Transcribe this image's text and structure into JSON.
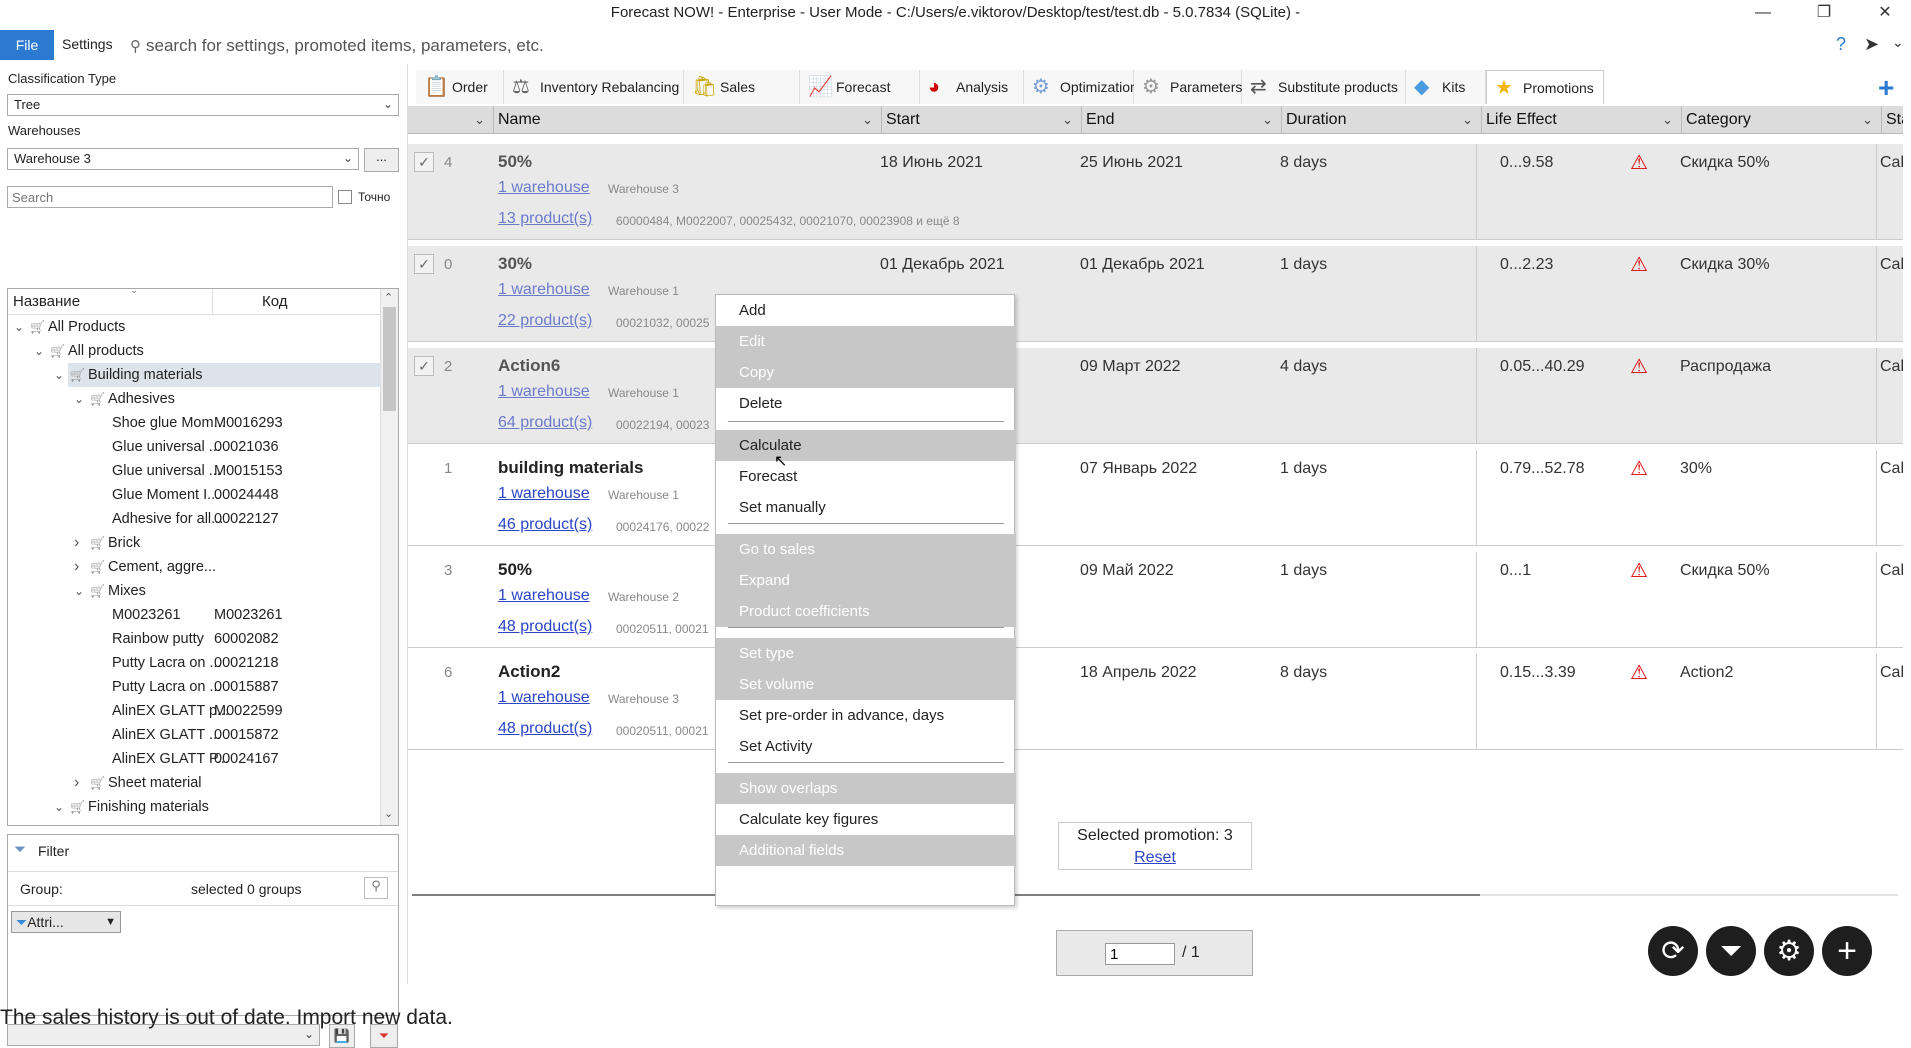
{
  "window": {
    "title": "Forecast NOW! - Enterprise - User Mode - C:/Users/e.viktorov/Desktop/test/test.db - 5.0.7834 (SQLite) -",
    "minimize": "—",
    "restore": "❐",
    "close": "✕"
  },
  "menubar": {
    "file": "File",
    "settings": "Settings",
    "search_placeholder": "search for settings, promoted items, parameters, etc.",
    "help": "?",
    "send": "➤",
    "chevron": "⌄"
  },
  "left": {
    "classification_label": "Classification Type",
    "classification_value": "Tree",
    "warehouses_label": "Warehouses",
    "warehouse_value": "Warehouse 3",
    "more_btn": "...",
    "search_placeholder": "Search",
    "exact_label": "Точно",
    "tree_header_name": "Название",
    "tree_header_code": "Код",
    "tree": [
      {
        "label": "All Products",
        "code": ""
      },
      {
        "label": "All products",
        "code": ""
      },
      {
        "label": "Building materials",
        "code": ""
      },
      {
        "label": "Adhesives",
        "code": ""
      },
      {
        "label": "Shoe glue Mom...",
        "code": "M0016293"
      },
      {
        "label": "Glue universal ...",
        "code": "00021036"
      },
      {
        "label": "Glue universal ...",
        "code": "M0015153"
      },
      {
        "label": "Glue Moment I...",
        "code": "00024448"
      },
      {
        "label": "Adhesive for all...",
        "code": "00022127"
      },
      {
        "label": "Brick",
        "code": ""
      },
      {
        "label": "Cement, aggre...",
        "code": ""
      },
      {
        "label": "Mixes",
        "code": ""
      },
      {
        "label": "M0023261",
        "code": "M0023261"
      },
      {
        "label": "Rainbow putty",
        "code": "60002082"
      },
      {
        "label": "Putty Lacra on ...",
        "code": "00021218"
      },
      {
        "label": "Putty Lacra on ...",
        "code": "00015887"
      },
      {
        "label": "AlinEX GLATT p...",
        "code": "M0022599"
      },
      {
        "label": "AlinEX GLATT ...",
        "code": "00015872"
      },
      {
        "label": "AlinEX GLATT P...",
        "code": "00024167"
      },
      {
        "label": "Sheet material",
        "code": ""
      },
      {
        "label": "Finishing materials",
        "code": ""
      }
    ],
    "filter_title": "Filter",
    "group_label": "Group:",
    "group_value": "selected 0 groups",
    "attr_btn": "Attri..."
  },
  "tabs": [
    {
      "label": "Order",
      "icon": "order-icon",
      "glyph": "📋"
    },
    {
      "label": "Inventory Rebalancing",
      "icon": "scales-icon",
      "glyph": "⚖"
    },
    {
      "label": "Sales",
      "icon": "sales-icon",
      "glyph": "🛍"
    },
    {
      "label": "Forecast",
      "icon": "chart-icon",
      "glyph": "📈"
    },
    {
      "label": "Analysis",
      "icon": "pie-icon",
      "glyph": "◕"
    },
    {
      "label": "Optimization",
      "icon": "optimization-icon",
      "glyph": "⚙"
    },
    {
      "label": "Parameters",
      "icon": "gear-icon",
      "glyph": "⚙"
    },
    {
      "label": "Substitute products",
      "icon": "substitute-icon",
      "glyph": "⇄"
    },
    {
      "label": "Kits",
      "icon": "box-icon",
      "glyph": "◆"
    },
    {
      "label": "Promotions",
      "icon": "star-icon",
      "glyph": "★"
    }
  ],
  "grid": {
    "headers": [
      "Name",
      "Start",
      "End",
      "Duration",
      "Life Effect",
      "Category",
      "Sta"
    ],
    "rows": [
      {
        "checked": true,
        "idx": "4",
        "name": "50%",
        "start": "18 Июнь 2021",
        "end": "25 Июнь 2021",
        "duration": "8 days",
        "life": "0...9.58",
        "category": "Скидка 50%",
        "status": "Cal",
        "wh_link": "1 warehouse",
        "wh": "Warehouse 3",
        "prod_link": "13 product(s)",
        "prods": "60000484, M0022007, 00025432, 00021070, 00023908 и ещё 8"
      },
      {
        "checked": true,
        "idx": "0",
        "name": "30%",
        "start": "01 Декабрь 2021",
        "end": "01 Декабрь 2021",
        "duration": "1 days",
        "life": "0...2.23",
        "category": "Скидка 30%",
        "status": "Cal",
        "wh_link": "1 warehouse",
        "wh": "Warehouse 1",
        "prod_link": "22 product(s)",
        "prods": "00021032, 00025"
      },
      {
        "checked": true,
        "idx": "2",
        "name": "Action6",
        "start": "",
        "end": "09 Март 2022",
        "duration": "4 days",
        "life": "0.05...40.29",
        "category": "Распродажа",
        "status": "Cal",
        "wh_link": "1 warehouse",
        "wh": "Warehouse 1",
        "prod_link": "64 product(s)",
        "prods": "00022194, 00023"
      },
      {
        "checked": false,
        "idx": "1",
        "name": "building materials",
        "start": "",
        "end": "07 Январь 2022",
        "duration": "1 days",
        "life": "0.79...52.78",
        "category": "30%",
        "status": "Cal",
        "wh_link": "1 warehouse",
        "wh": "Warehouse 1",
        "prod_link": "46 product(s)",
        "prods": "00024176, 00022"
      },
      {
        "checked": false,
        "idx": "3",
        "name": "50%",
        "start": "",
        "end": "09 Май 2022",
        "duration": "1 days",
        "life": "0...1",
        "category": "Скидка 50%",
        "status": "Cal",
        "wh_link": "1 warehouse",
        "wh": "Warehouse 2",
        "prod_link": "48 product(s)",
        "prods": "00020511, 00021"
      },
      {
        "checked": false,
        "idx": "6",
        "name": "Action2",
        "start": "",
        "end": "18 Апрель 2022",
        "duration": "8 days",
        "life": "0.15...3.39",
        "category": "Action2",
        "status": "Cal",
        "wh_link": "1 warehouse",
        "wh": "Warehouse 3",
        "prod_link": "48 product(s)",
        "prods": "00020511, 00021"
      }
    ]
  },
  "selected": {
    "text": "Selected promotion: 3",
    "reset": "Reset"
  },
  "pager": {
    "page": "1",
    "total": "/ 1"
  },
  "context_menu": {
    "items": [
      "Add",
      "Edit",
      "Copy",
      "Delete",
      "Calculate",
      "Forecast",
      "Set manually",
      "Go to sales",
      "Expand",
      "Product coefficients",
      "Set type",
      "Set volume",
      "Set pre-order in advance, days",
      "Set Activity",
      "Show overlaps",
      "Calculate key figures",
      "Additional fields"
    ]
  },
  "bottom_buttons": [
    "⟳",
    "⏷",
    "⚙",
    "+"
  ],
  "status_text": "The sales history is out of date. Import new data.",
  "colors": {
    "accent": "#2b79d0",
    "link": "#2a45c6",
    "warning": "#dd0000"
  }
}
